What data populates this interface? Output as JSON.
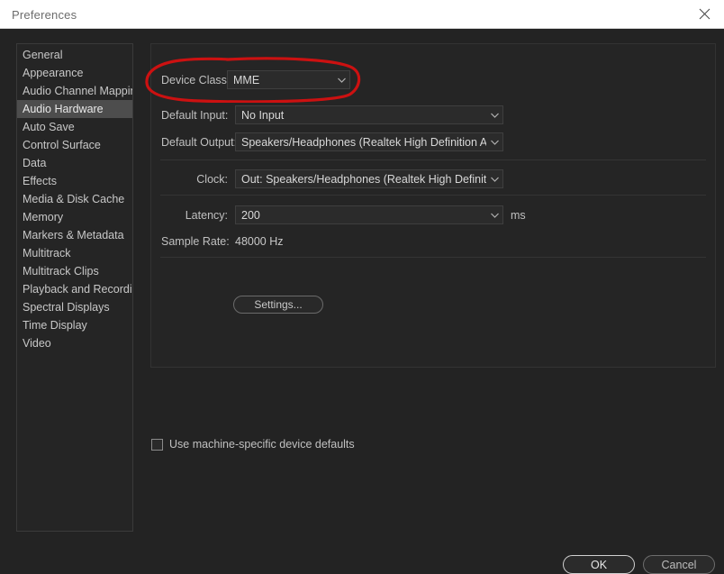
{
  "window": {
    "title": "Preferences",
    "close_icon": "close-icon"
  },
  "sidebar": {
    "items": [
      {
        "label": "General",
        "selected": false
      },
      {
        "label": "Appearance",
        "selected": false
      },
      {
        "label": "Audio Channel Mapping",
        "selected": false
      },
      {
        "label": "Audio Hardware",
        "selected": true
      },
      {
        "label": "Auto Save",
        "selected": false
      },
      {
        "label": "Control Surface",
        "selected": false
      },
      {
        "label": "Data",
        "selected": false
      },
      {
        "label": "Effects",
        "selected": false
      },
      {
        "label": "Media & Disk Cache",
        "selected": false
      },
      {
        "label": "Memory",
        "selected": false
      },
      {
        "label": "Markers & Metadata",
        "selected": false
      },
      {
        "label": "Multitrack",
        "selected": false
      },
      {
        "label": "Multitrack Clips",
        "selected": false
      },
      {
        "label": "Playback and Recording",
        "selected": false
      },
      {
        "label": "Spectral Displays",
        "selected": false
      },
      {
        "label": "Time Display",
        "selected": false
      },
      {
        "label": "Video",
        "selected": false
      }
    ]
  },
  "main": {
    "section_title": "Audio Hardware",
    "fields": {
      "device_class": {
        "label": "Device Class:",
        "value": "MME",
        "chevron": "chevron-down-icon"
      },
      "default_input": {
        "label": "Default Input:",
        "value": "No Input",
        "chevron": "chevron-down-icon"
      },
      "default_output": {
        "label": "Default Output:",
        "value": "Speakers/Headphones (Realtek High Definition Audio)",
        "chevron": "chevron-down-icon"
      },
      "clock": {
        "label": "Clock:",
        "value": "Out: Speakers/Headphones (Realtek High Definition A...",
        "chevron": "chevron-down-icon"
      },
      "latency": {
        "label": "Latency:",
        "value": "200",
        "suffix": "ms",
        "chevron": "chevron-down-icon"
      },
      "sample_rate": {
        "label": "Sample Rate:",
        "value": "48000 Hz"
      }
    },
    "settings_button": "Settings...",
    "machine_defaults_checkbox": {
      "label": "Use machine-specific device defaults",
      "checked": false
    }
  },
  "footer": {
    "ok_label": "OK",
    "cancel_label": "Cancel"
  },
  "annotation": {
    "shape": "red-ellipse-highlight",
    "color": "#cc1111",
    "target": "Device Class"
  },
  "colors": {
    "window_background": "#232323",
    "panel_background": "#252525",
    "titlebar_background": "#ffffff",
    "selected_item": "#4d4d4d",
    "field_background": "#2b2b2b",
    "annotation_red": "#cc1111"
  }
}
